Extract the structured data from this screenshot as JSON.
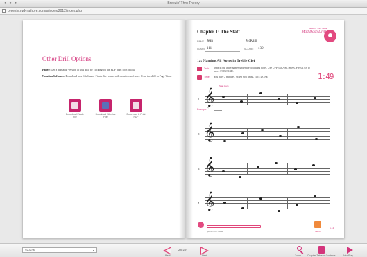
{
  "window": {
    "title": "Breezin' Thru Theory",
    "traffic_lights": "● ● ●"
  },
  "address": {
    "url": "breezin.rudyrathore.com/s/index/2012/index.php"
  },
  "left_page": {
    "title": "Other Drill Options",
    "para1_label": "Paper:",
    "para1_text": " Get a printable version of this drill by clicking on the PDF print icon below.",
    "para2_label": "Notation Software:",
    "para2_text": " Download as a Sibelius or Finale file to use with notation software. Print the drill in Page View.",
    "downloads": [
      {
        "label": "Download Finale File",
        "icon": "finale-file-icon"
      },
      {
        "label": "Download Sibelius File",
        "icon": "sibelius-file-icon"
      },
      {
        "label": "Download & Print PDF",
        "icon": "print-pdf-icon"
      }
    ]
  },
  "right_page": {
    "chapter": "Chapter 1: The Staff",
    "brand_small": "Breezin' Thru Music",
    "brand_big": "Mad Dash Drills",
    "name_label": "NAME",
    "first_name": "Jean",
    "last_name": "McKain",
    "class_label": "CLASS",
    "class_value": "111",
    "score_label": "SCORE:",
    "score_value": "/ 39",
    "section": "1a: Naming All Notes in Treble Clef",
    "task_label": "Task",
    "task_text": "Type in the letter names under the following notes. Use UPPERCASE letters. Press TAB to move FORWARD.",
    "time_label": "Time",
    "time_text": "You have 2 minutes. When you finish, click DONE.",
    "timer": "1:49",
    "start_note": "Start Here",
    "example_label": "Example",
    "example_value": "C",
    "staff_numbers": [
      "1.",
      "2.",
      "3.",
      "4."
    ],
    "progress_help": "(points in bar: but fill)",
    "menu_label": "Menu",
    "page_no": "1.1a"
  },
  "toolbar": {
    "search_value": "Search",
    "back_label": "Back",
    "next_label": "Next",
    "pages": "28-29",
    "zoom_label": "Zoom",
    "toc_label": "Chapter Table of Contents",
    "auto_play_label": "Auto Play"
  },
  "colors": {
    "accent": "#d4357c",
    "timer": "#e0467a",
    "menu": "#f08a3c"
  }
}
